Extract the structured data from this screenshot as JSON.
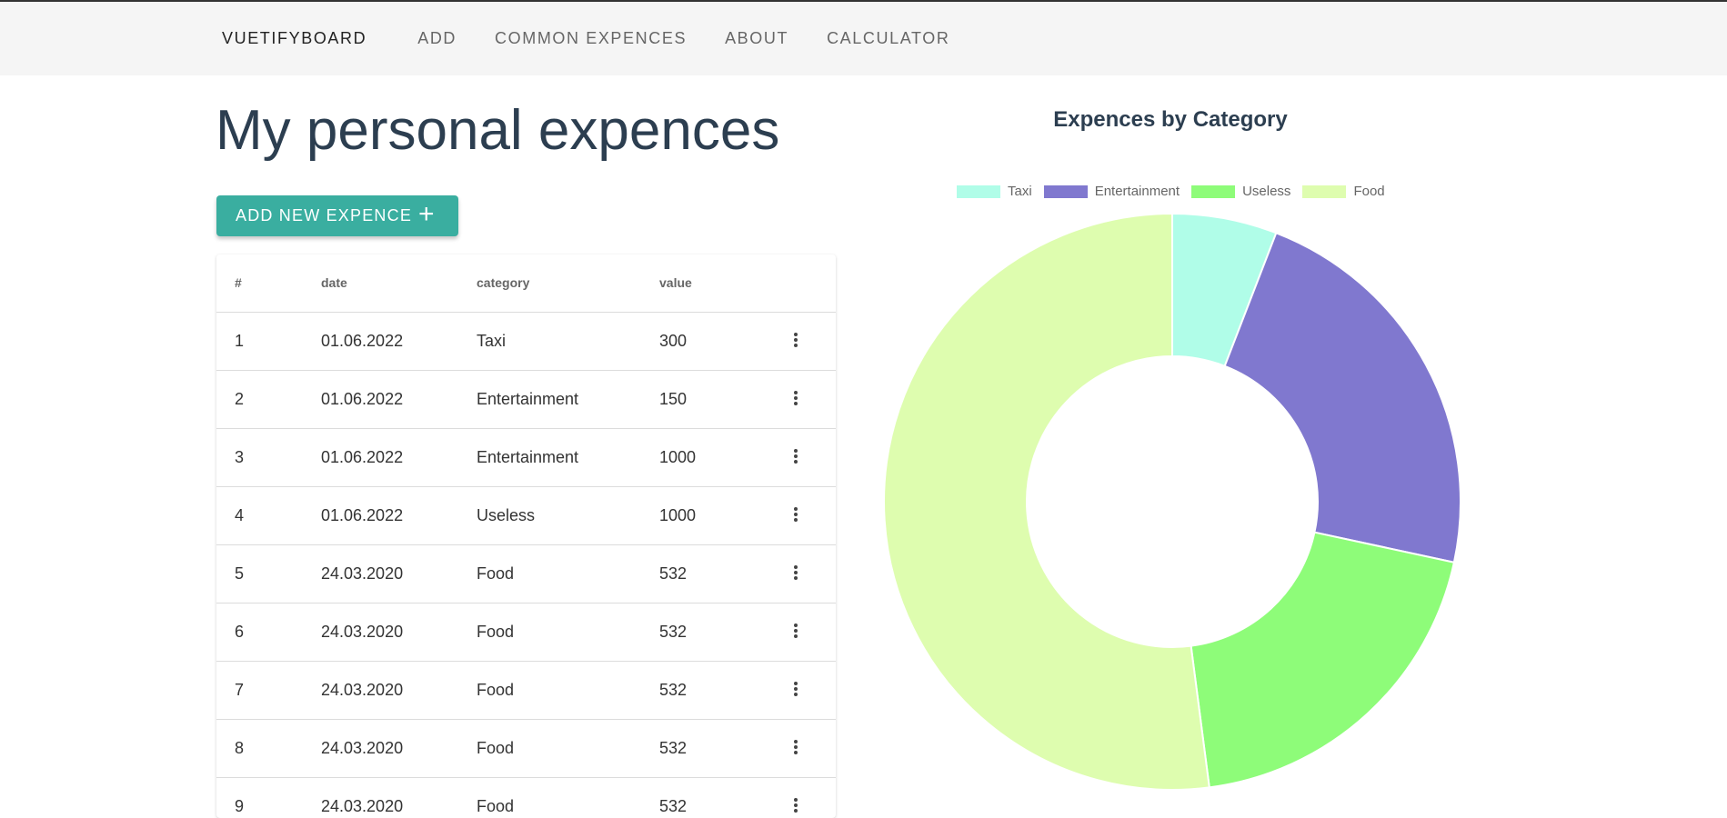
{
  "nav": {
    "brand": "VUETIFYBOARD",
    "items": [
      "ADD",
      "COMMON EXPENCES",
      "ABOUT",
      "CALCULATOR"
    ]
  },
  "page": {
    "title": "My personal expences"
  },
  "add_button": {
    "label": "ADD NEW EXPENCE",
    "icon": "plus-icon"
  },
  "table": {
    "headers": [
      "#",
      "date",
      "category",
      "value"
    ],
    "rows": [
      [
        "1",
        "01.06.2022",
        "Taxi",
        "300"
      ],
      [
        "2",
        "01.06.2022",
        "Entertainment",
        "150"
      ],
      [
        "3",
        "01.06.2022",
        "Entertainment",
        "1000"
      ],
      [
        "4",
        "01.06.2022",
        "Useless",
        "1000"
      ],
      [
        "5",
        "24.03.2020",
        "Food",
        "532"
      ],
      [
        "6",
        "24.03.2020",
        "Food",
        "532"
      ],
      [
        "7",
        "24.03.2020",
        "Food",
        "532"
      ],
      [
        "8",
        "24.03.2020",
        "Food",
        "532"
      ],
      [
        "9",
        "24.03.2020",
        "Food",
        "532"
      ]
    ],
    "row_menu_icon": "more-vertical-icon"
  },
  "chart_data": {
    "type": "pie",
    "title": "Expences by Category",
    "categories": [
      "Taxi",
      "Entertainment",
      "Useless",
      "Food"
    ],
    "values": [
      300,
      1150,
      1000,
      2660
    ],
    "colors": [
      "#b0fde8",
      "#8078cf",
      "#8efc79",
      "#defdaf"
    ],
    "legend_position": "top"
  }
}
